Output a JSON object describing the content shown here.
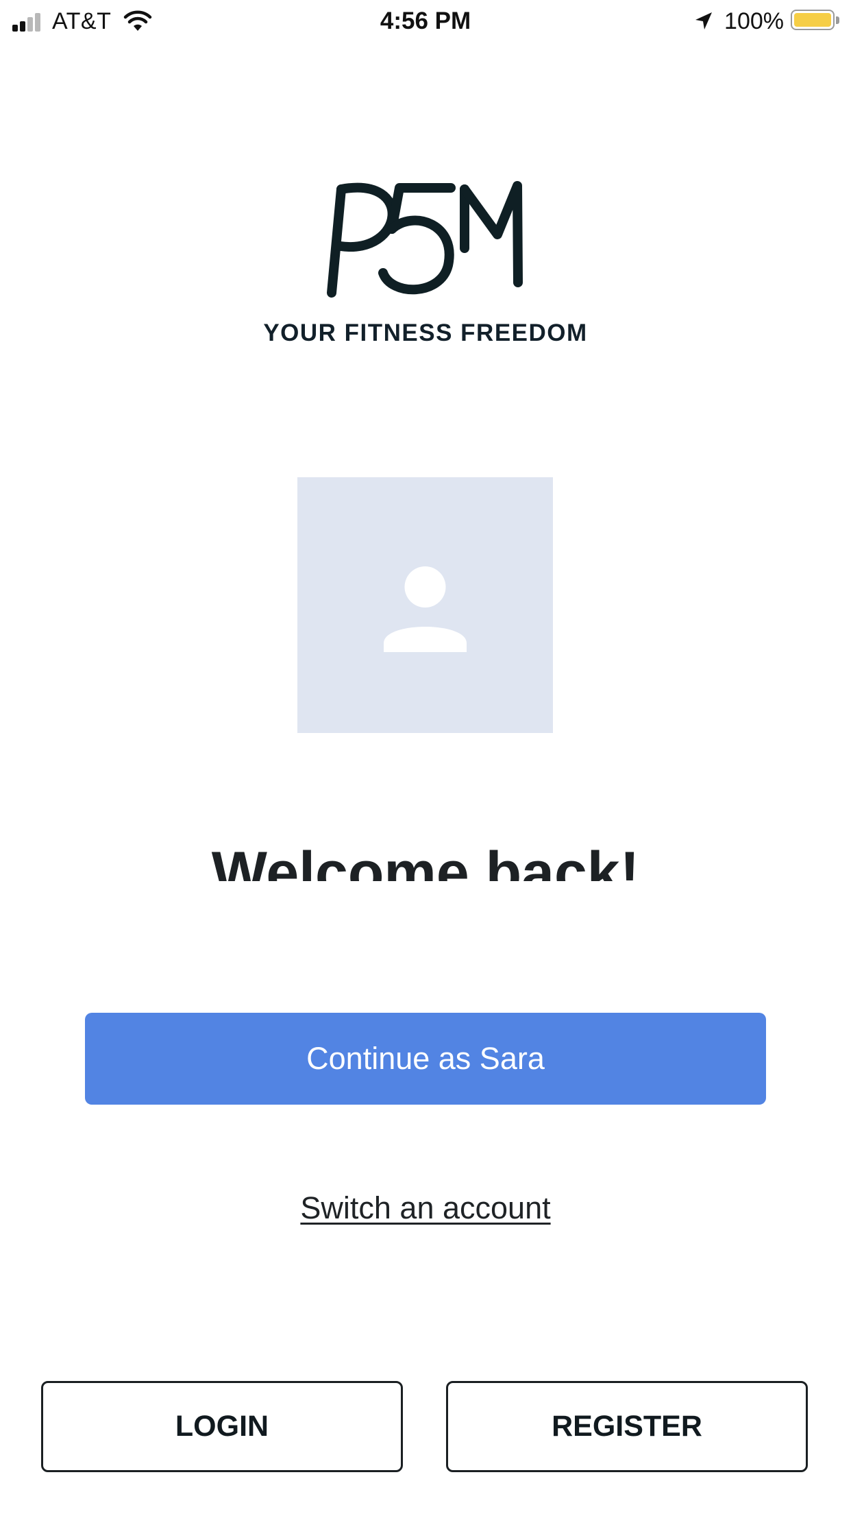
{
  "status_bar": {
    "carrier": "AT&T",
    "time": "4:56 PM",
    "battery_percent": "100%",
    "battery_color": "#f6ce46",
    "icons": [
      "signal-icon",
      "wifi-icon",
      "location-arrow-icon",
      "battery-icon"
    ]
  },
  "brand": {
    "logo": "P5M",
    "tagline": "YOUR FITNESS FREEDOM"
  },
  "avatar": {
    "icon": "user-placeholder-icon",
    "background": "#dfe5f1"
  },
  "welcome": {
    "heading": "Welcome back!"
  },
  "actions": {
    "continue_label": "Continue as Sara",
    "continue_color": "#5284e3",
    "switch_label": "Switch an account",
    "login_label": "LOGIN",
    "register_label": "REGISTER"
  }
}
